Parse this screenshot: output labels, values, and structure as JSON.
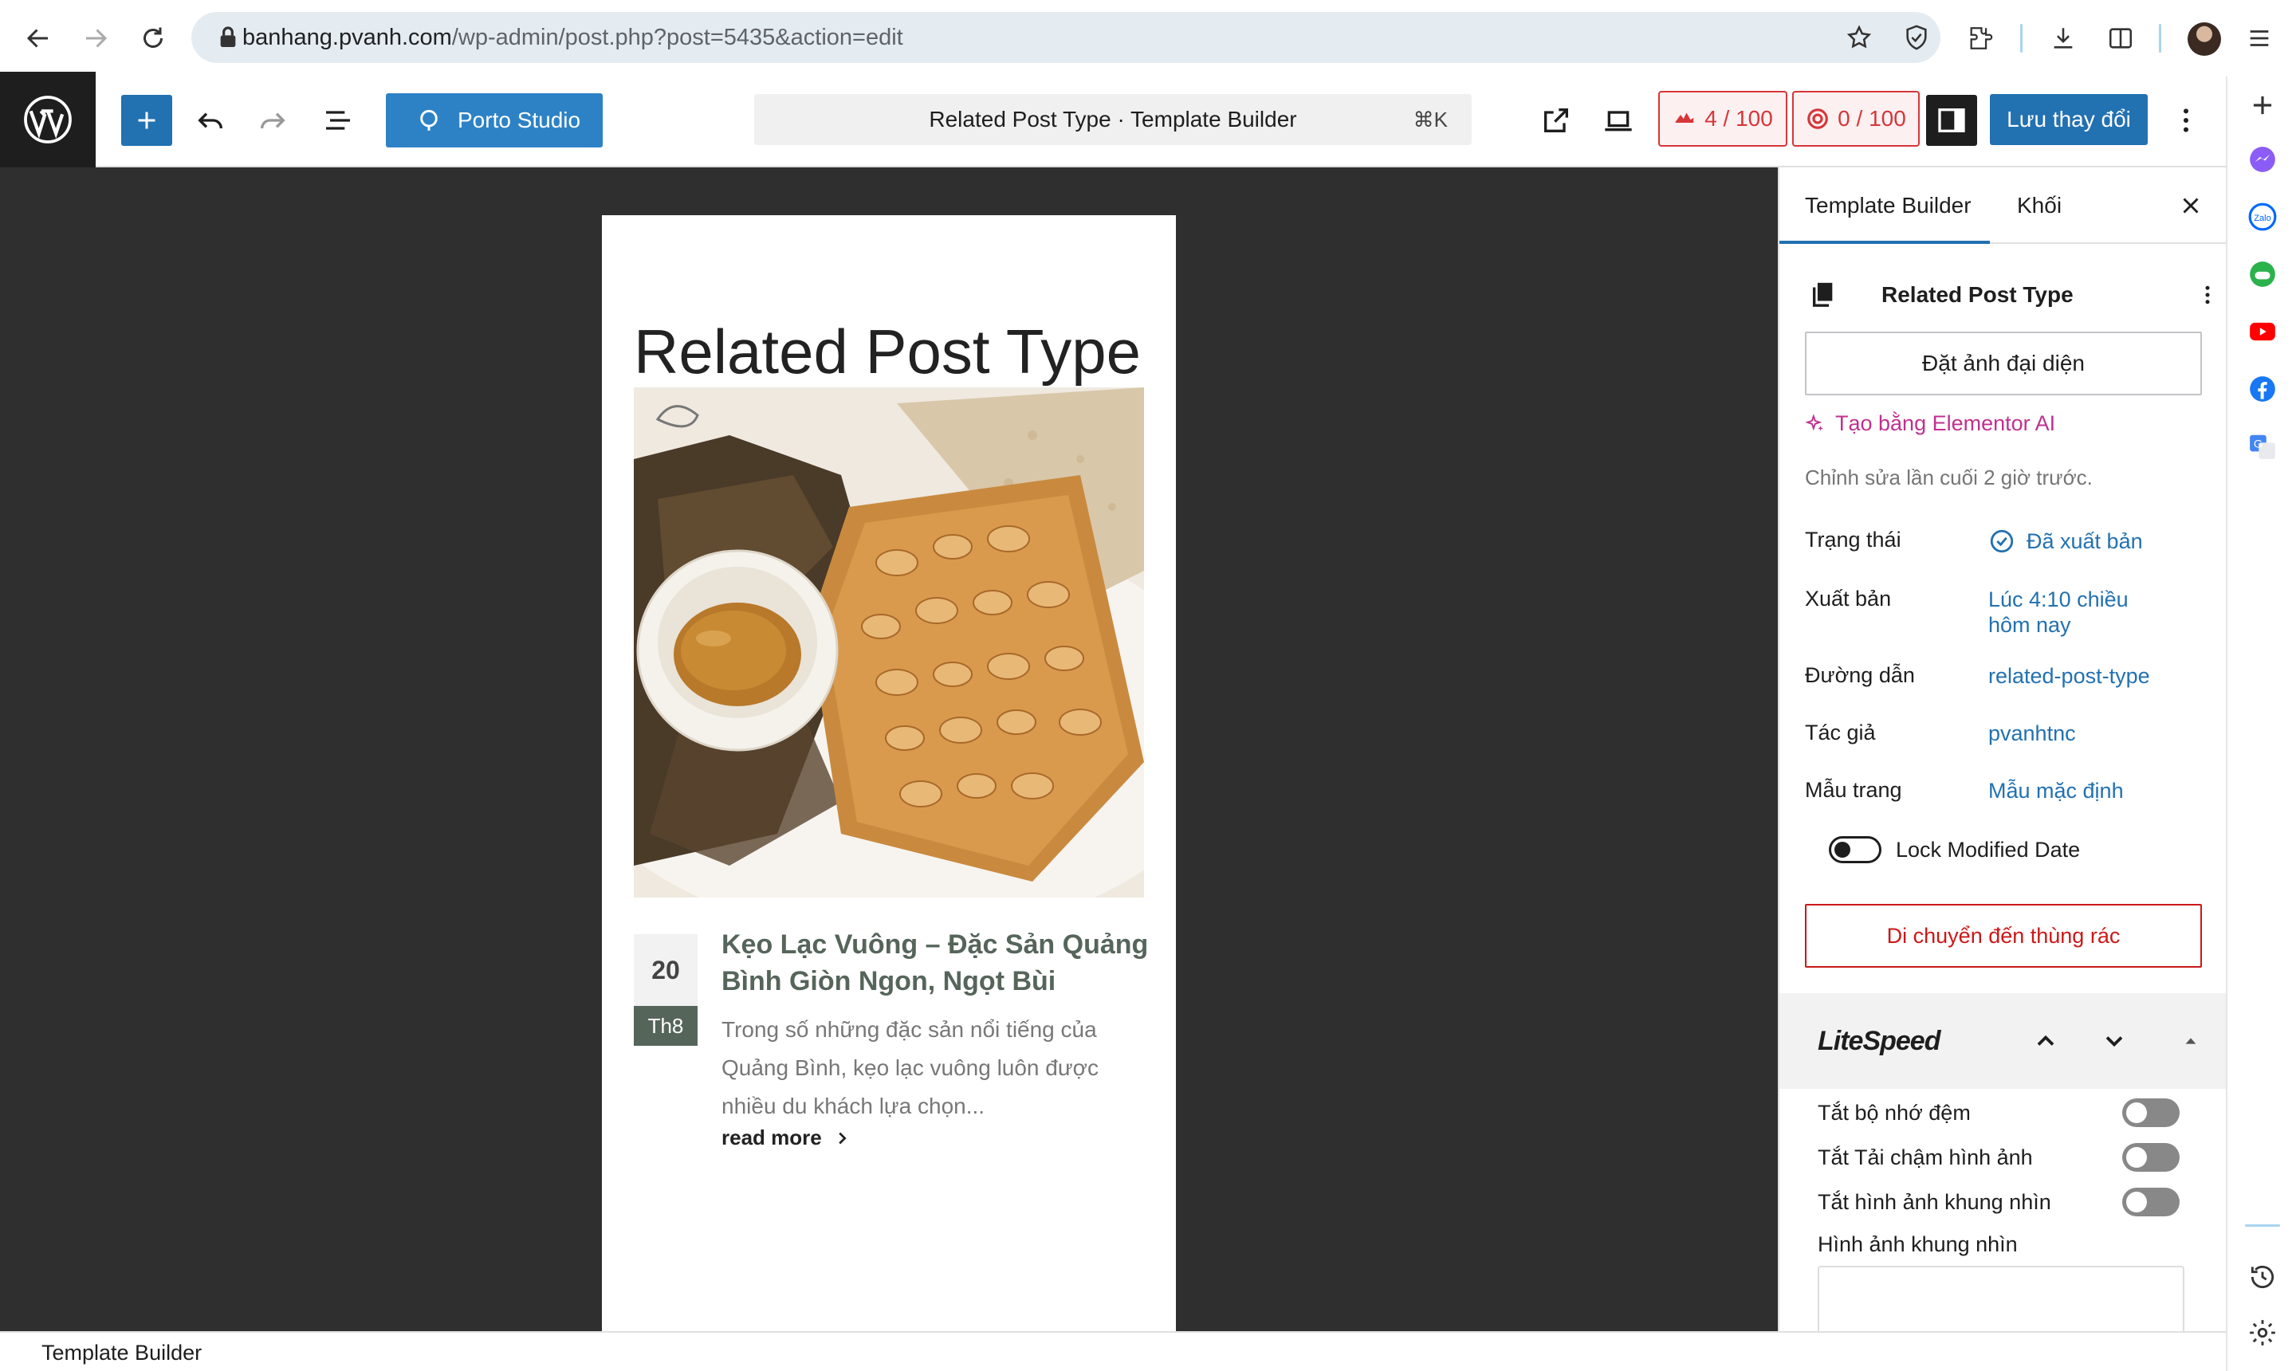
{
  "browser": {
    "url_host": "banhang.pvanh.com",
    "url_path": "/wp-admin/post.php?post=5435&action=edit"
  },
  "toolbar": {
    "porto_label": "Porto Studio",
    "command_title": "Related Post Type · Template Builder",
    "command_shortcut": "⌘K",
    "score_a": "4 / 100",
    "score_b": "0 / 100",
    "save_label": "Lưu thay đổi"
  },
  "canvas": {
    "post_title": "Related Post Type",
    "card": {
      "day": "20",
      "month": "Th8",
      "title": "Kẹo Lạc Vuông – Đặc Sản Quảng Bình Giòn Ngon, Ngọt Bùi",
      "excerpt": "Trong số những đặc sản nổi tiếng của Quảng Bình, kẹo lạc vuông luôn được nhiều du khách lựa chọn...",
      "read_more": "read more"
    }
  },
  "sidebar": {
    "tabs": [
      {
        "label": "Template Builder",
        "active": true
      },
      {
        "label": "Khối",
        "active": false
      }
    ],
    "doc_title": "Related Post Type",
    "featured_image_btn": "Đặt ảnh đại diện",
    "ai_link": "Tạo bằng Elementor AI",
    "last_edited": "Chỉnh sửa lần cuối 2 giờ trước.",
    "meta": [
      {
        "label": "Trạng thái",
        "value": "Đã xuất bản"
      },
      {
        "label": "Xuất bản",
        "value": "Lúc 4:10 chiều hôm nay"
      },
      {
        "label": "Đường dẫn",
        "value": "related-post-type"
      },
      {
        "label": "Tác giả",
        "value": "pvanhtnc"
      },
      {
        "label": "Mẫu trang",
        "value": "Mẫu mặc định"
      }
    ],
    "lock_modified_label": "Lock Modified Date",
    "trash_btn": "Di chuyển đến thùng rác",
    "litespeed": {
      "title": "LiteSpeed",
      "rows": [
        {
          "label": "Tắt bộ nhớ đệm",
          "on": false
        },
        {
          "label": "Tắt Tải chậm hình ảnh",
          "on": false
        },
        {
          "label": "Tắt hình ảnh khung nhìn",
          "on": false
        }
      ],
      "viewport_label": "Hình ảnh khung nhìn"
    }
  },
  "footer": {
    "breadcrumb": "Template Builder"
  },
  "colors": {
    "wp_blue": "#2271b1",
    "danger": "#cc1818",
    "canvas_bg": "#2f2f2f",
    "ai_purple": "#c1308f",
    "card_green": "#56655a"
  }
}
